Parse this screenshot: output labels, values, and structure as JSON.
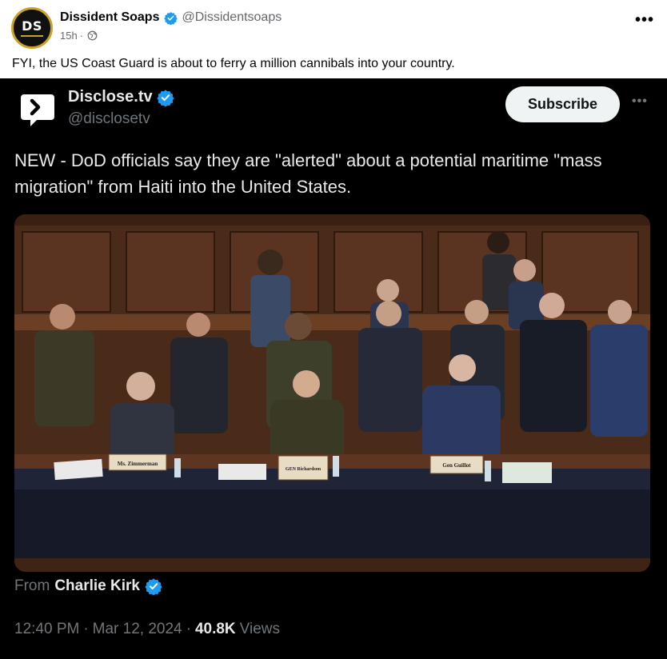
{
  "post": {
    "author": {
      "avatar_initials": "DS",
      "name": "Dissident Soaps",
      "handle": "@Dissidentsoaps"
    },
    "time_ago": "15h",
    "meta_separator": "·",
    "privacy_icon": "globe-icon",
    "more_icon": "•••",
    "text": "FYI, the US Coast Guard is about to ferry a million cannibals into your country."
  },
  "embed": {
    "account_name": "Disclose.tv",
    "account_handle": "@disclosetv",
    "subscribe_label": "Subscribe",
    "more_icon": "•••",
    "text": "NEW - DoD officials say they are \"alerted\" about a potential maritime \"mass migration\" from Haiti into the United States.",
    "video": {
      "placards": [
        "Ms. Zimmerman",
        "GEN Richardson",
        "Gen Guillot"
      ]
    },
    "from_prefix": "From",
    "from_name": "Charlie Kirk",
    "time": "12:40 PM",
    "date": "Mar 12, 2024",
    "views_count": "40.8K",
    "views_label": "Views",
    "separator": "·"
  },
  "colors": {
    "verified_blue": "#1d9bf0",
    "embed_background": "#000000",
    "avatar_ring": "#c9a227"
  }
}
